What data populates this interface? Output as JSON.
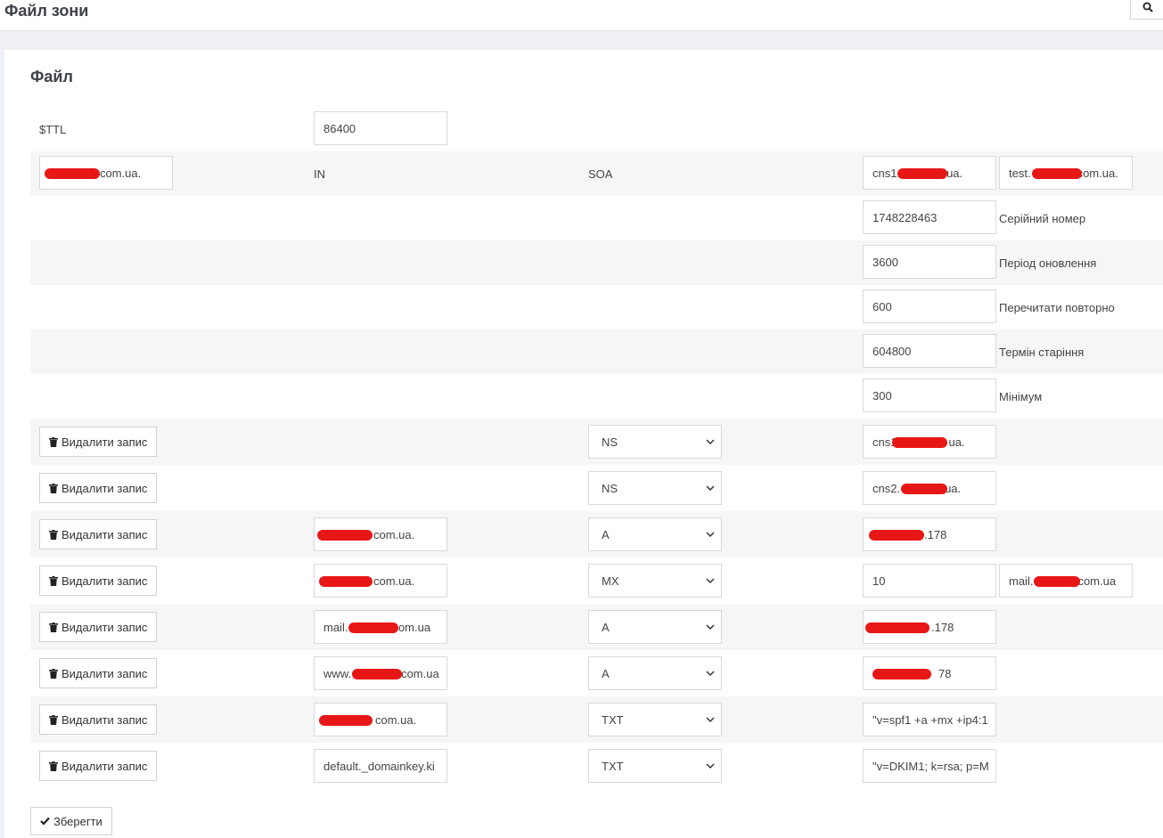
{
  "header": {
    "title": "Файл зони",
    "search_icon": "search-icon"
  },
  "section": {
    "title": "Файл"
  },
  "ttl": {
    "label": "$TTL",
    "value": "86400"
  },
  "soa": {
    "name": "com.ua.",
    "class": "IN",
    "type": "SOA",
    "primary_ns": "cns1.",
    "primary_ns_tail": "ua.",
    "contact": "test.",
    "contact_tail": "com.ua.",
    "fields": [
      {
        "value": "1748228463",
        "label": "Серійний номер"
      },
      {
        "value": "3600",
        "label": "Період оновлення"
      },
      {
        "value": "600",
        "label": "Перечитати повторно"
      },
      {
        "value": "604800",
        "label": "Термін старіння"
      },
      {
        "value": "300",
        "label": "Мінімум"
      }
    ]
  },
  "delete_label": "Видалити запис",
  "records": [
    {
      "name": "",
      "type": "NS",
      "value": "cns1",
      "value_tail": "ua.",
      "extra": ""
    },
    {
      "name": "",
      "type": "NS",
      "value": "cns2.",
      "value_tail": "ua.",
      "extra": ""
    },
    {
      "name": "com.ua.",
      "type": "A",
      "value": "",
      "value_tail": ".178",
      "extra": ""
    },
    {
      "name": "com.ua.",
      "type": "MX",
      "value": "10",
      "value_tail": "",
      "extra": "mail.",
      "extra_tail": "com.ua"
    },
    {
      "name": "mail.",
      "name_tail": "com.ua",
      "type": "A",
      "value": "",
      "value_tail": ".178",
      "extra": ""
    },
    {
      "name": "www.",
      "name_tail": "com.ua",
      "type": "A",
      "value": "",
      "value_tail": "78",
      "extra": ""
    },
    {
      "name": "com.ua.",
      "type": "TXT",
      "value": "\"v=spf1 +a +mx +ip4:1",
      "value_tail": "",
      "extra": ""
    },
    {
      "name": "default._domainkey.ki",
      "type": "TXT",
      "value": "\"v=DKIM1; k=rsa; p=M",
      "value_tail": "",
      "extra": ""
    }
  ],
  "save_label": "Зберегти",
  "colors": {
    "redaction": "#e81717",
    "stripe": "#f6f6f6"
  }
}
